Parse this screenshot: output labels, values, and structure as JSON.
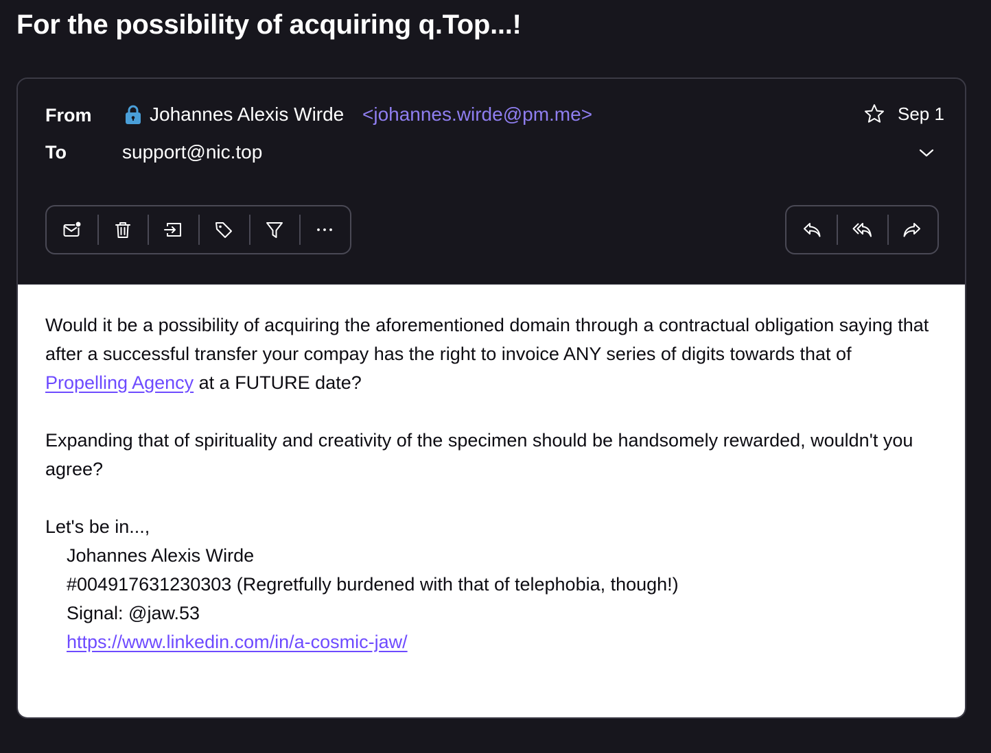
{
  "subject": "For the possibility of acquiring q.Top...!",
  "header": {
    "from_label": "From",
    "to_label": "To",
    "sender_name": "Johannes Alexis Wirde",
    "sender_address": "<johannes.wirde@pm.me>",
    "recipient": "support@nic.top",
    "date": "Sep 1",
    "lock_icon": "lock-icon",
    "lock_color": "#4a9fd9"
  },
  "toolbar": {
    "left_actions": [
      "mark-unread-icon",
      "trash-icon",
      "move-to-folder-icon",
      "label-tag-icon",
      "filter-icon",
      "more-options-icon"
    ],
    "right_actions": [
      "reply-icon",
      "reply-all-icon",
      "forward-icon"
    ]
  },
  "body": {
    "paragraph1_start": "Would it be a possibility of acquiring the aforementioned domain through a contractual obligation saying that after a successful transfer your compay has the right to invoice ANY series of digits towards that of ",
    "paragraph1_link": "Propelling Agency",
    "paragraph1_end": " at a FUTURE date?",
    "paragraph2": "Expanding that of spirituality and creativity of the specimen should be handsomely rewarded, wouldn't you agree?",
    "signoff": "Let's be in...,",
    "signature_name": "Johannes Alexis Wirde",
    "signature_phone": "#004917631230303 (Regretfully burdened with that of telephobia, though!)",
    "signature_signal": "Signal: @jaw.53",
    "signature_link": "https://www.linkedin.com/in/a-cosmic-jaw/"
  },
  "colors": {
    "background": "#17161d",
    "accent": "#8f7ef0",
    "link": "#6d4aff",
    "border": "#3b3a45"
  }
}
